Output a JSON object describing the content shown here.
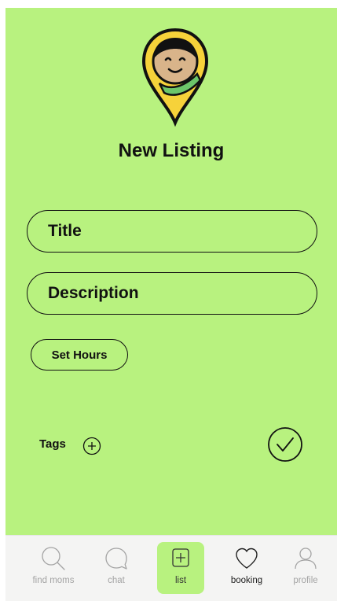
{
  "page": {
    "title": "New Listing"
  },
  "form": {
    "title_placeholder": "Title",
    "description_placeholder": "Description",
    "set_hours_label": "Set Hours",
    "tags_label": "Tags"
  },
  "nav": {
    "items": [
      {
        "label": "find moms",
        "icon": "search-icon",
        "active": false
      },
      {
        "label": "chat",
        "icon": "chat-bubble-icon",
        "active": false
      },
      {
        "label": "list",
        "icon": "plus-square-icon",
        "active": true
      },
      {
        "label": "booking",
        "icon": "heart-icon",
        "active": false
      },
      {
        "label": "profile",
        "icon": "person-icon",
        "active": false
      }
    ]
  },
  "colors": {
    "background": "#b8f27f",
    "nav_background": "#f4f4f3",
    "logo_yellow": "#f6d23a",
    "text": "#111111"
  }
}
